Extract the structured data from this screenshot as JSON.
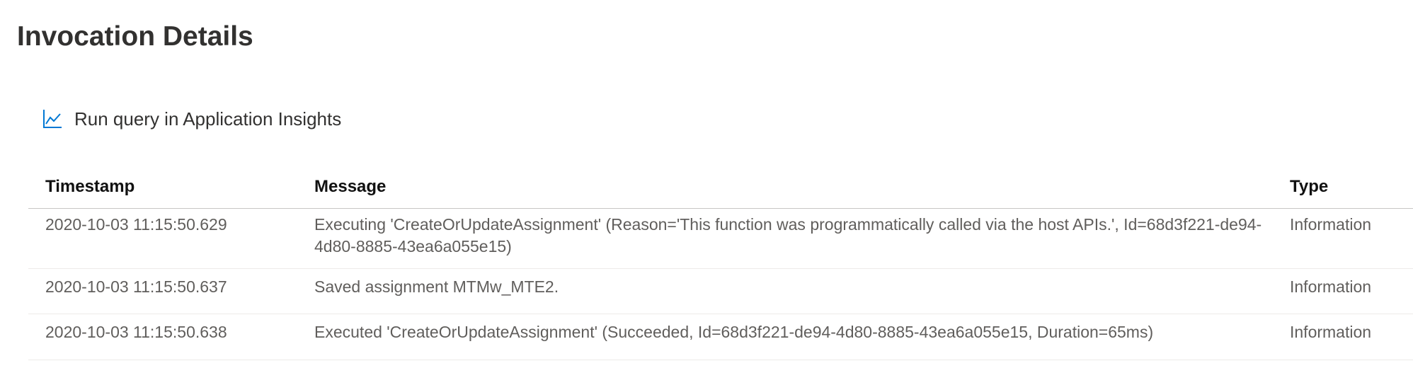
{
  "page": {
    "title": "Invocation Details"
  },
  "toolbar": {
    "run_query_label": "Run query in Application Insights",
    "run_query_icon": "line-chart-icon",
    "accent": "#0078d4"
  },
  "table": {
    "columns": [
      "Timestamp",
      "Message",
      "Type"
    ],
    "rows": [
      {
        "timestamp": "2020-10-03 11:15:50.629",
        "message": "Executing 'CreateOrUpdateAssignment' (Reason='This function was programmatically called via the host APIs.', Id=68d3f221-de94-4d80-8885-43ea6a055e15)",
        "type": "Information"
      },
      {
        "timestamp": "2020-10-03 11:15:50.637",
        "message": "Saved assignment MTMw_MTE2.",
        "type": "Information"
      },
      {
        "timestamp": "2020-10-03 11:15:50.638",
        "message": "Executed 'CreateOrUpdateAssignment' (Succeeded, Id=68d3f221-de94-4d80-8885-43ea6a055e15, Duration=65ms)",
        "type": "Information"
      }
    ]
  }
}
